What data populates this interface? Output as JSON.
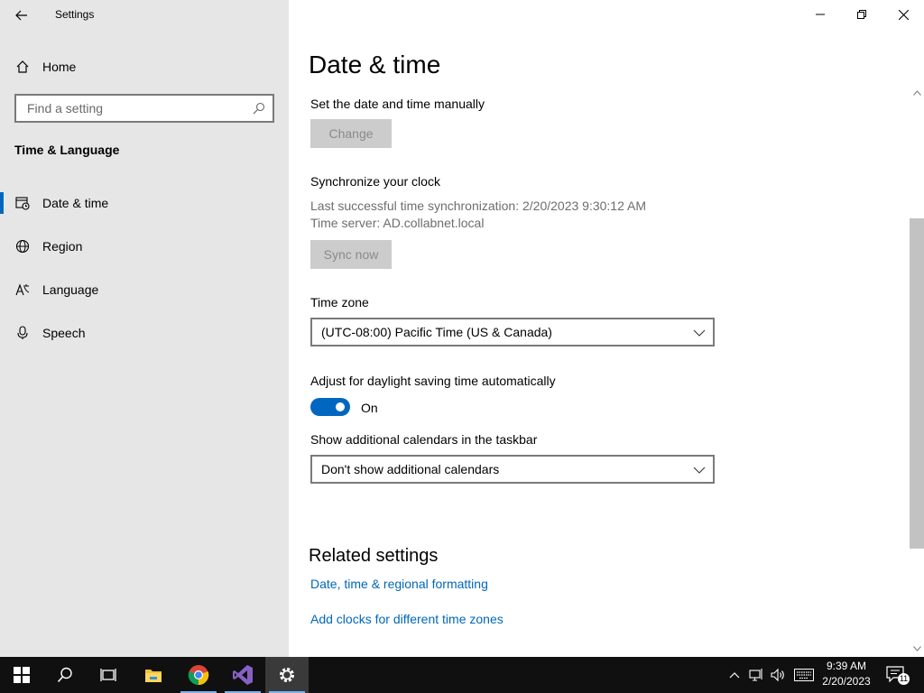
{
  "window": {
    "title": "Settings"
  },
  "sidebar": {
    "home_label": "Home",
    "search_placeholder": "Find a setting",
    "section_title": "Time & Language",
    "items": [
      {
        "label": "Date & time",
        "icon": "calendar-clock-icon",
        "active": true
      },
      {
        "label": "Region",
        "icon": "globe-icon",
        "active": false
      },
      {
        "label": "Language",
        "icon": "language-icon",
        "active": false
      },
      {
        "label": "Speech",
        "icon": "microphone-icon",
        "active": false
      }
    ]
  },
  "main": {
    "page_title": "Date & time",
    "manual": {
      "label": "Set the date and time manually",
      "button": "Change"
    },
    "sync": {
      "label": "Synchronize your clock",
      "last_sync": "Last successful time synchronization: 2/20/2023 9:30:12 AM",
      "server": "Time server: AD.collabnet.local",
      "button": "Sync now"
    },
    "timezone": {
      "label": "Time zone",
      "value": "(UTC-08:00) Pacific Time (US & Canada)"
    },
    "dst": {
      "label": "Adjust for daylight saving time automatically",
      "state": "On"
    },
    "calendars": {
      "label": "Show additional calendars in the taskbar",
      "value": "Don't show additional calendars"
    },
    "related": {
      "title": "Related settings",
      "links": [
        "Date, time & regional formatting",
        "Add clocks for different time zones"
      ]
    }
  },
  "taskbar": {
    "apps": [
      "start-icon",
      "search-icon",
      "task-view-icon",
      "file-explorer-icon",
      "chrome-icon",
      "visual-studio-icon",
      "settings-icon"
    ],
    "clock": {
      "time": "9:39 AM",
      "date": "2/20/2023"
    },
    "notification_count": "11"
  },
  "colors": {
    "accent": "#0067c0",
    "link": "#0067b8",
    "sidebar_bg": "#e6e6e6",
    "taskbar_bg": "#101010"
  }
}
